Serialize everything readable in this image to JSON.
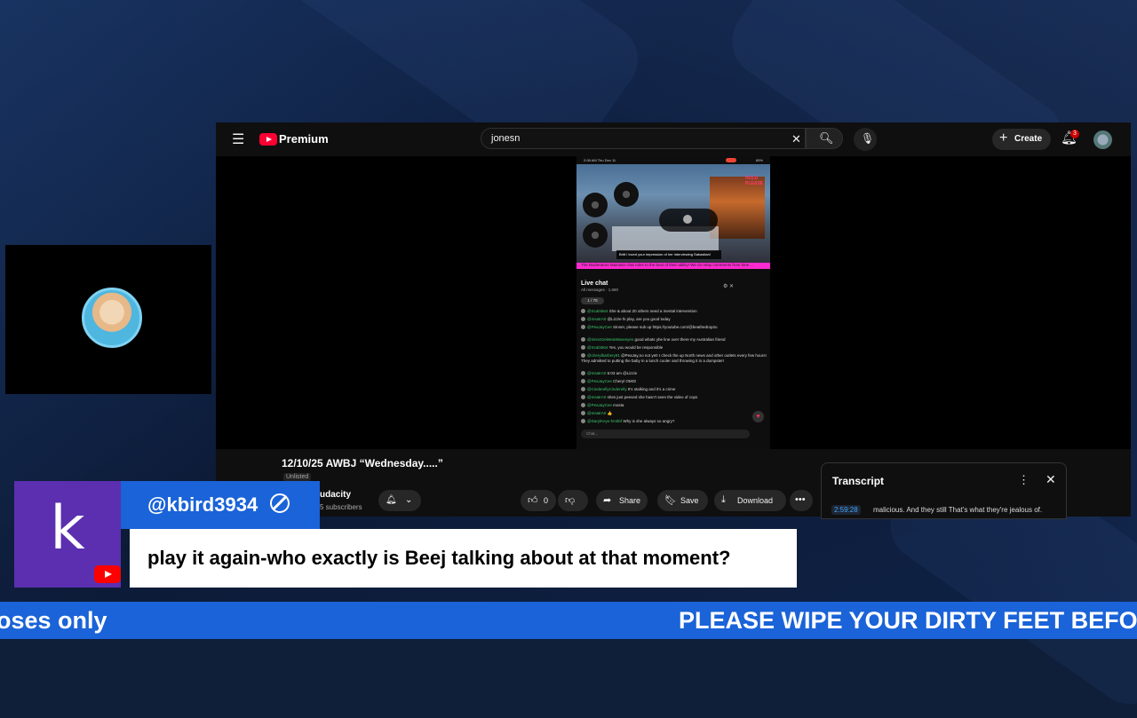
{
  "youtube": {
    "brand": "Premium",
    "search_value": "jonesn",
    "create_label": "Create",
    "notification_count": "3",
    "phone_status": {
      "time": "2:08 AM Thu Dec 11",
      "battery": "85%"
    },
    "stream_badge": "HOLD PLEASE",
    "stream_caption": "Britt I loved your impression of her interviewing Sabastian!",
    "stream_ticker": "... The Moderators Maintain chat rules to the best of their ability! We do relay comments from time ...",
    "live_chat": {
      "title": "Live chat",
      "subtitle": "All messages · 1,680",
      "pill": "1 / 78",
      "messages": [
        {
          "name": "@Scabi564",
          "text": "She & about 20 others need a mental intervention"
        },
        {
          "name": "@msatrA0",
          "text": "@Lizzie hi play, are you good today"
        },
        {
          "name": "@PeaJayCee",
          "text": "Sinner, please sub up https://youtube.com/@beathedrop2u"
        },
        {
          "name": "@missSzeleteaWaveeyes",
          "text": "good whats yhe line over there my Australian friend"
        },
        {
          "name": "@Scabi564",
          "text": "Yes, you would be responsible"
        },
        {
          "name": "@cherylbarbery91",
          "text": "@PeaJay,no not yet! I check the up North news and other outlets every few hours! They admitted to putting the baby in a lunch cooler and throwing it in a dumpster!"
        },
        {
          "name": "@msatrA0",
          "text": "5:03 am @Lizzie"
        },
        {
          "name": "@PeaJayCee",
          "text": "Cheryl OMG!"
        },
        {
          "name": "@CinderellyCinderelly",
          "text": "It's stalking and it's a crime"
        },
        {
          "name": "@msatrA0",
          "text": "shes just peeved she hasn't seen the video of cops"
        },
        {
          "name": "@PeaJayCee",
          "text": "mosta"
        },
        {
          "name": "@msatrA0",
          "text": "👍"
        },
        {
          "name": "@DarylKeys-hm5bf",
          "text": "Why is she always so angry?"
        }
      ],
      "input_placeholder": "Chat..."
    },
    "video_title": "12/10/25 AWBJ “Wednesday.....”",
    "visibility": "Unlisted",
    "channel_name": "udacity",
    "channel_subs": "5 subscribers",
    "likes": "0",
    "actions": {
      "share": "Share",
      "save": "Save",
      "download": "Download"
    },
    "transcript": {
      "title": "Transcript",
      "time": "2:59:28",
      "text": "malicious. And they still That's what they're jealous of."
    }
  },
  "comment": {
    "avatar_letter": "k",
    "username": "@kbird3934",
    "text": "play it again-who exactly is Beej talking about at that moment?"
  },
  "ticker": {
    "left_text": "oses only",
    "right_text": "PLEASE WIPE YOUR DIRTY FEET BEFORE"
  },
  "colors": {
    "accent_blue": "#1a63d8",
    "avatar_purple": "#5b2fb0",
    "youtube_red": "#ff0000"
  }
}
